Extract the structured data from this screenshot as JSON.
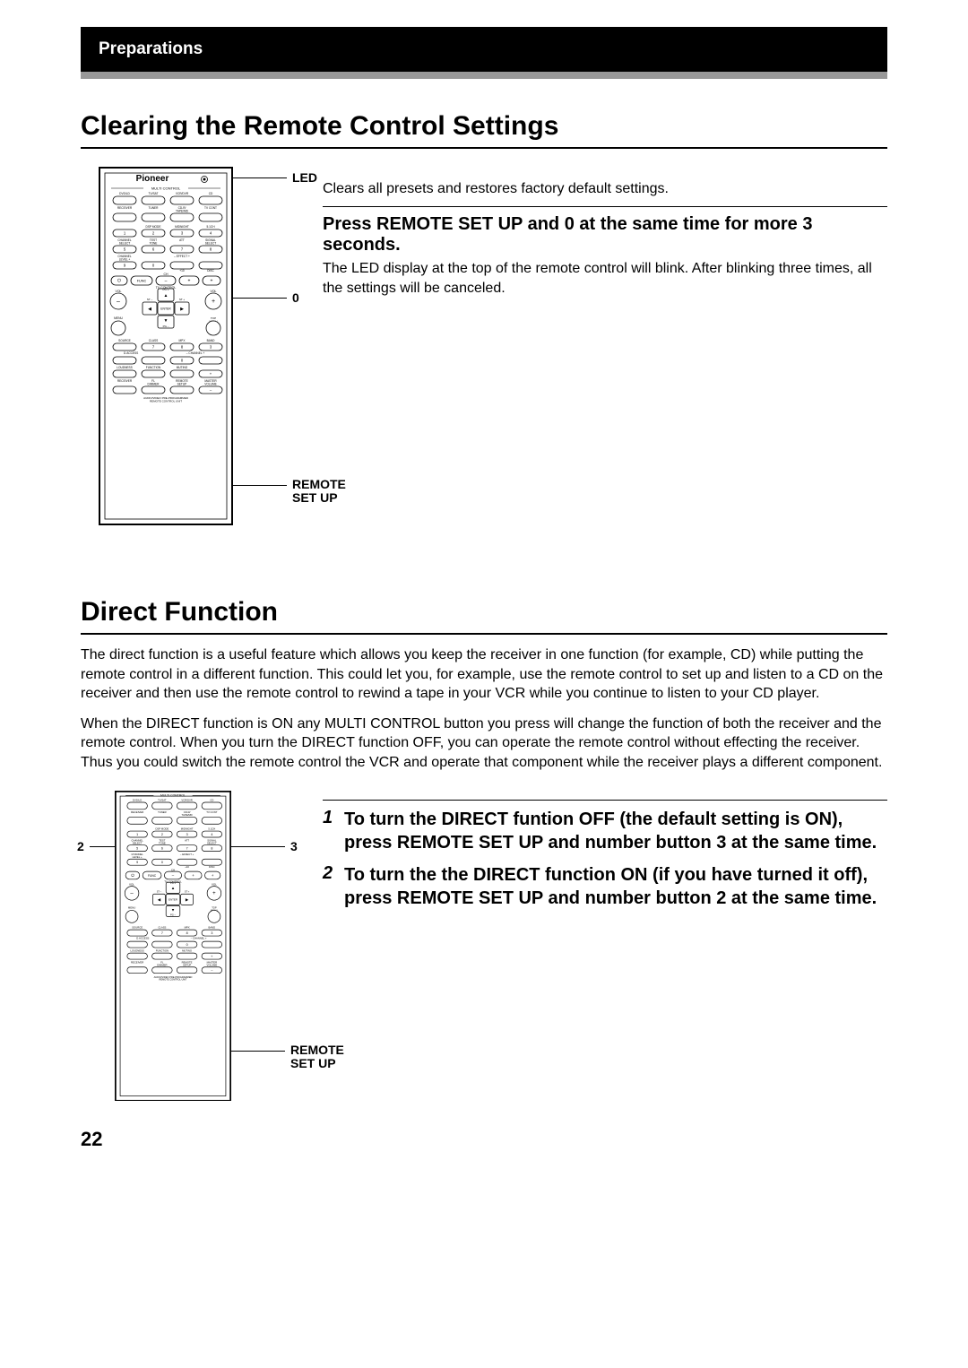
{
  "header": {
    "section": "Preparations"
  },
  "section1": {
    "title": "Clearing the Remote Control Settings",
    "intro": "Clears all presets and restores factory default settings.",
    "step_title": "Press REMOTE SET UP and 0 at the same time for more 3 seconds.",
    "step_body": "The LED display at the top of the remote control will blink. After blinking three times, all the settings will be canceled.",
    "callouts": {
      "led": "LED",
      "zero": "0",
      "remote_setup": "REMOTE SET UP"
    }
  },
  "section2": {
    "title": "Direct Function",
    "para1": "The direct function is a useful feature which allows you keep the receiver in one function (for example, CD) while putting the remote control in a different function. This could let you, for example, use the remote control to set up and listen to a CD on the receiver and then use the remote control to rewind a tape in your VCR while you continue to listen to your CD player.",
    "para2": "When the DIRECT function is ON any MULTI CONTROL button you press will change the function of both the receiver and the remote control. When you turn the DIRECT function OFF, you can operate the remote control without effecting the receiver. Thus you could switch the remote control the VCR and operate that component while the receiver plays a different component.",
    "steps": [
      {
        "num": "1",
        "text": "To turn the DIRECT funtion OFF (the default setting is ON), press REMOTE SET UP and number button 3 at the same time."
      },
      {
        "num": "2",
        "text": "To turn the the DIRECT function ON (if you have turned it off), press REMOTE SET UP and number button 2 at the same time."
      }
    ],
    "callouts": {
      "two": "2",
      "three": "3",
      "remote_setup": "REMOTE SET UP"
    }
  },
  "page_number": "22",
  "remote": {
    "brand": "Pioneer",
    "labels": {
      "multi": "MULTI CONTROL",
      "row1": [
        "DVD/LD",
        "TV/SAT",
        "VCR/DVR",
        "CD"
      ],
      "row2": [
        "RECEIVER",
        "TUNER",
        "CD-R/\nTAPE/MD",
        "TV CONT"
      ],
      "moderow_top": [
        "",
        "DSP MODE",
        "MIDNIGHT",
        "5.1CH"
      ],
      "moderow1": [
        "1",
        "2",
        "3",
        "4"
      ],
      "moderow_mid": [
        "CHANNEL\nSELECT",
        "TEST\nTONE",
        "ATT",
        "SIGNAL\nSELECT"
      ],
      "moderow2": [
        "5",
        "6",
        "7",
        "8"
      ],
      "moderow_bot": [
        "CHANNEL\nLEVEL +",
        "",
        "– EFFECT +",
        ""
      ],
      "moderow3": [
        "9",
        "0",
        "",
        ""
      ],
      "plus10disc": [
        "+10",
        "DISC"
      ],
      "tvcontrol": "TV CONTROL",
      "func": "FUNC",
      "ch": "CH",
      "vol_l": "VOL",
      "vol_r": "VOL",
      "pgplus": "PG +",
      "pgminus": "PG –",
      "stminus": "ST –",
      "stplus": "ST +",
      "enter": "ENTER",
      "menu": "MENU",
      "topmenu": "TOP\nMENU",
      "bottomrow1_top": [
        "SOURCE",
        "CLASS",
        "MPX",
        "BAND"
      ],
      "bottomrow1": [
        "",
        "7",
        "8",
        "3"
      ],
      "daccess": "D.ACCESS",
      "channelpm": "– CHANNEL +",
      "bottomrow2": [
        "",
        "",
        "0",
        ""
      ],
      "bottomrow3_top": [
        "LOUDNESS",
        "FUNCTION",
        "MUTING",
        ""
      ],
      "bottomrow3": [
        "",
        "",
        "",
        "+"
      ],
      "bottomrow4_top": [
        "RECEIVER",
        "FL\nDIMMER",
        "REMOTE\nSETUP",
        "MASTER\nVOLUME"
      ],
      "bottomrow4": [
        "",
        "",
        "",
        "–"
      ],
      "footer": "AUDIO/VIDEO PRE-PROGRAMMED\nREMOTE CONTROL UNIT"
    }
  }
}
